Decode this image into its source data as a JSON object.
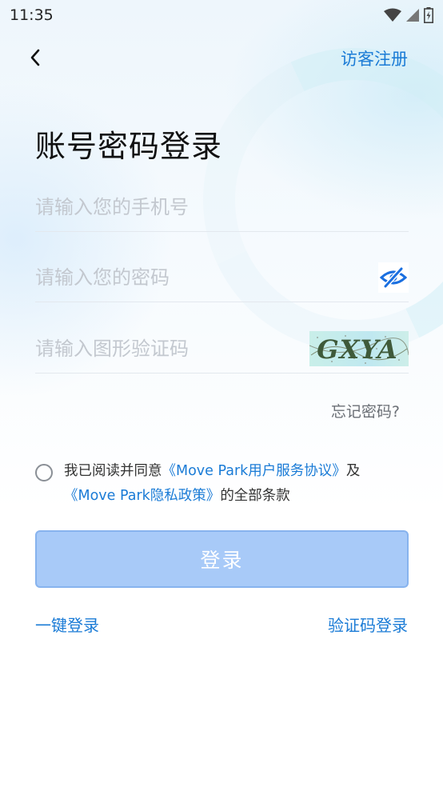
{
  "status_bar": {
    "time": "11:35",
    "icons": [
      "wifi-icon",
      "cell-signal-icon",
      "battery-charging-icon"
    ]
  },
  "header": {
    "back_icon": "chevron-left-icon",
    "guest_register": "访客注册"
  },
  "title": "账号密码登录",
  "form": {
    "phone": {
      "value": "",
      "placeholder": "请输入您的手机号"
    },
    "password": {
      "value": "",
      "placeholder": "请输入您的密码",
      "toggle_icon": "eye-off-icon"
    },
    "captcha": {
      "value": "",
      "placeholder": "请输入图形验证码",
      "image_text": "GXYA"
    }
  },
  "forgot_password": "忘记密码?",
  "agreement": {
    "prefix": "我已阅读并同意",
    "link1": "《Move Park用户服务协议》",
    "middle": "及",
    "link2": "《Move Park隐私政策》",
    "suffix": "的全部条款",
    "checked": false
  },
  "login_button": "登录",
  "alt_logins": {
    "one_key": "一键登录",
    "sms_code": "验证码登录"
  },
  "colors": {
    "accent": "#1a7bd6",
    "button_disabled": "#a8caf8",
    "placeholder": "#c3c8cf"
  }
}
